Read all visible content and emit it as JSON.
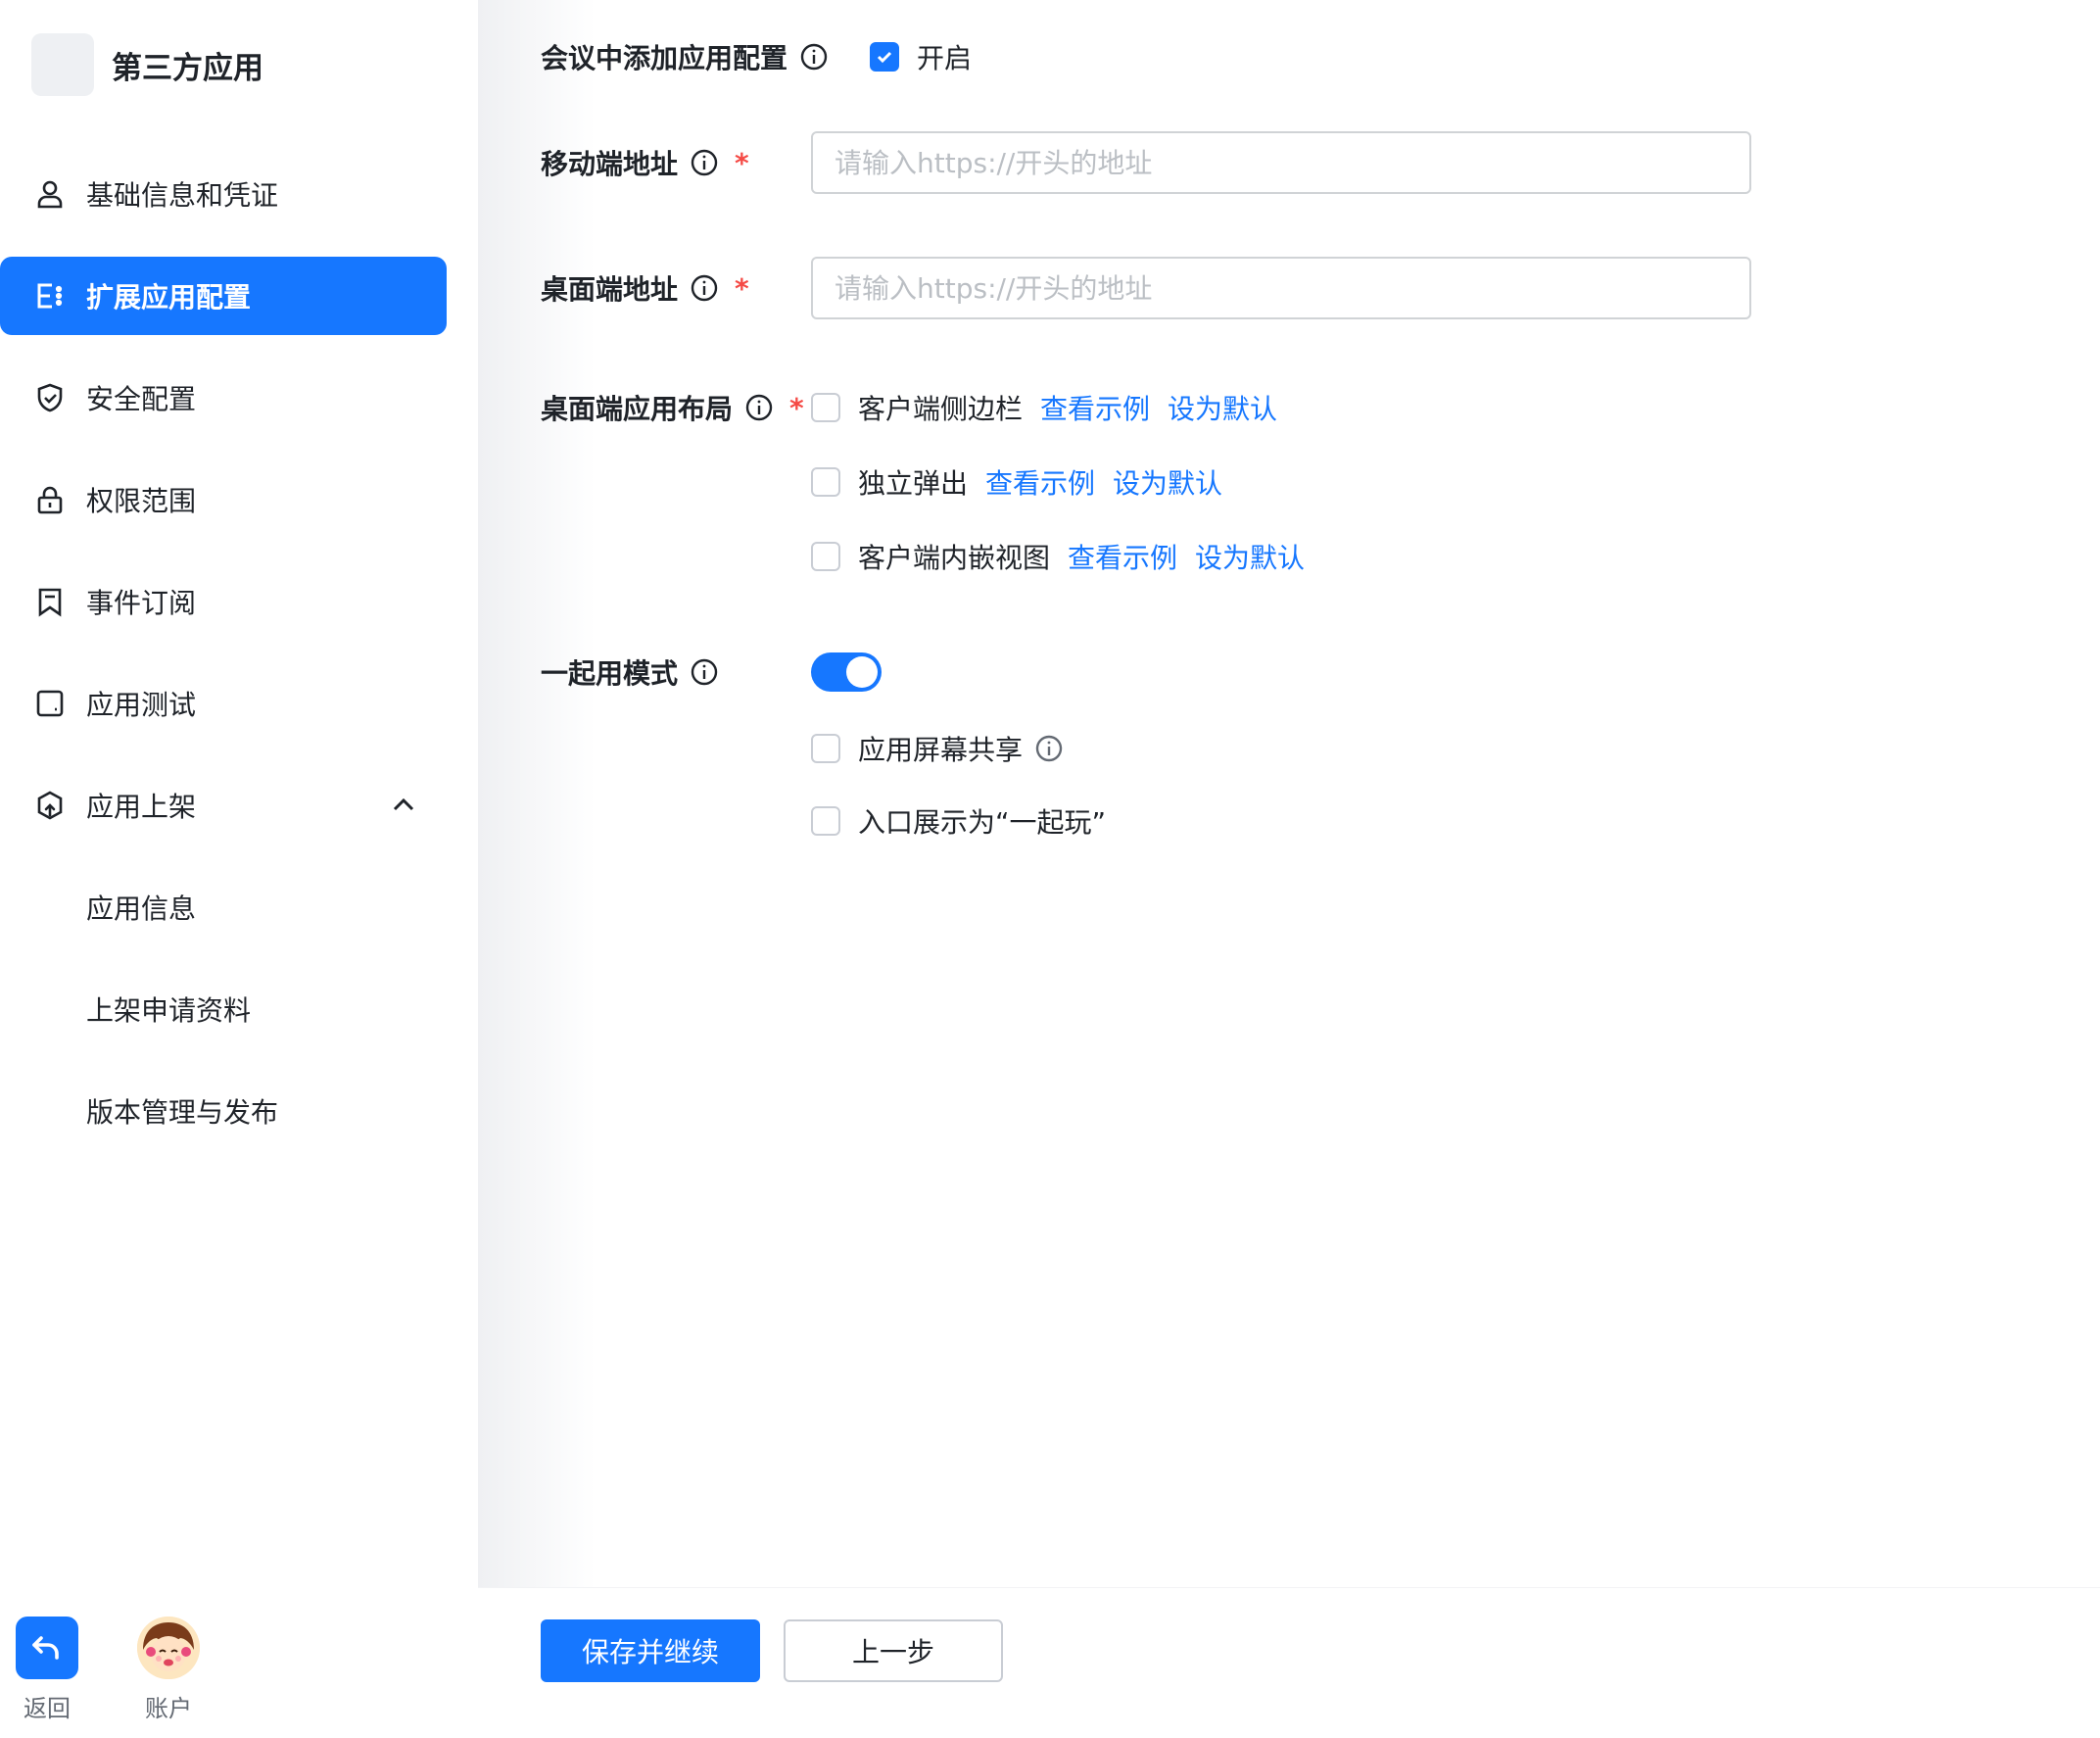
{
  "app": {
    "name": "第三方应用"
  },
  "sidebar": {
    "items": [
      {
        "label": "基础信息和凭证",
        "icon": "user-icon"
      },
      {
        "label": "扩展应用配置",
        "icon": "extension-icon",
        "active": true
      },
      {
        "label": "安全配置",
        "icon": "shield-icon"
      },
      {
        "label": "权限范围",
        "icon": "lock-icon"
      },
      {
        "label": "事件订阅",
        "icon": "bookmark-icon"
      },
      {
        "label": "应用测试",
        "icon": "tablet-icon"
      },
      {
        "label": "应用上架",
        "icon": "publish-icon",
        "expanded": true
      }
    ],
    "subitems": [
      {
        "label": "应用信息"
      },
      {
        "label": "上架申请资料"
      },
      {
        "label": "版本管理与发布"
      }
    ],
    "back_label": "返回",
    "account_label": "账户"
  },
  "form": {
    "meeting": {
      "label": "会议中添加应用配置",
      "checkbox_label": "开启",
      "checked": true
    },
    "mobile_url": {
      "label": "移动端地址",
      "required_mark": "*",
      "placeholder": "请输入https://开头的地址",
      "value": ""
    },
    "desktop_url": {
      "label": "桌面端地址",
      "required_mark": "*",
      "placeholder": "请输入https://开头的地址",
      "value": ""
    },
    "desktop_layout": {
      "label": "桌面端应用布局",
      "required_mark": "*",
      "options": [
        {
          "label": "客户端侧边栏",
          "example_link": "查看示例",
          "default_link": "设为默认",
          "checked": false
        },
        {
          "label": "独立弹出",
          "example_link": "查看示例",
          "default_link": "设为默认",
          "checked": false
        },
        {
          "label": "客户端内嵌视图",
          "example_link": "查看示例",
          "default_link": "设为默认",
          "checked": false
        }
      ]
    },
    "together_mode": {
      "label": "一起用模式",
      "enabled": true,
      "options": [
        {
          "label": "应用屏幕共享",
          "checked": false
        },
        {
          "label": "入口展示为“一起玩”",
          "checked": false
        }
      ]
    }
  },
  "footer": {
    "save_label": "保存并继续",
    "prev_label": "上一步"
  },
  "colors": {
    "accent": "#1677ff",
    "required": "#f54a45",
    "text": "#1f2329",
    "placeholder": "#bbbfc4"
  }
}
